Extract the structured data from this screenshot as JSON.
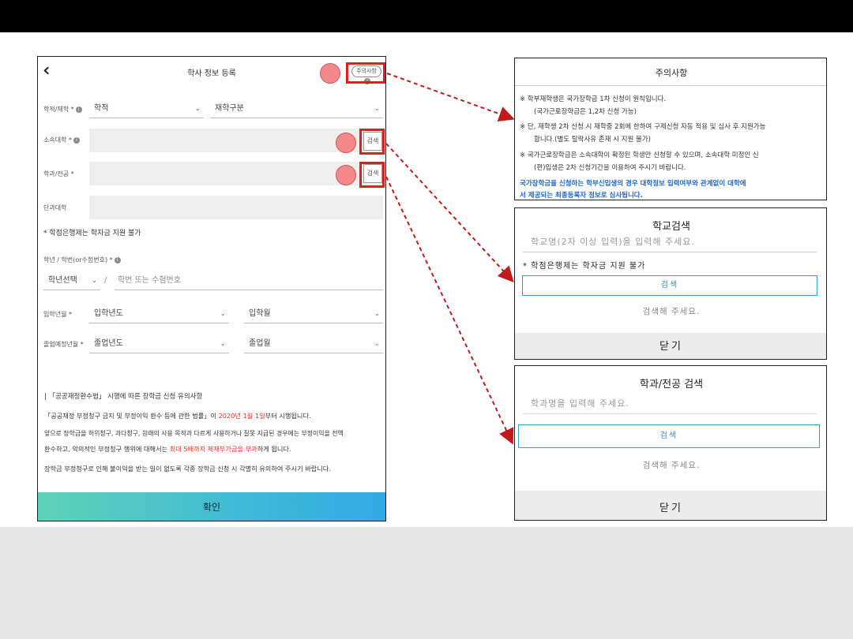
{
  "left": {
    "title": "학사 정보 등록",
    "notice_button": "주의사항",
    "info_glyph": "i",
    "rows": {
      "school_status_label": "학적/재학 *",
      "school_select": "학적",
      "enroll_select": "재학구분",
      "affiliation_label": "소속대학 *",
      "major_label": "학과/전공 *",
      "college_label": "단과대학",
      "search_label": "검색",
      "credit_bank_note": "* 학점은행제는 학자금 지원 불가",
      "student_id_label": "학년 / 학번(or수험번호) *",
      "grade_select": "학년선택",
      "slash": "/",
      "student_id_placeholder": "학번 또는 수험번호",
      "entrance_label": "입학년월 *",
      "entrance_year": "입학년도",
      "entrance_month": "입학월",
      "graduation_label": "졸업예정년월 *",
      "graduation_year": "졸업년도",
      "graduation_month": "졸업월"
    },
    "notice": {
      "heading": "| 「공공재정환수법」 시행에 따른 장학금 신청 유의사항",
      "line1a": "「공공재정 부정청구 금지 및 부정이익 환수 등에 관한 법률」이 ",
      "line1b": "2020년 1월 1일",
      "line1c": "부터 시행됩니다.",
      "line2": "앞으로 장학금을 허위청구, 과다청구, 원래의 사용 목적과 다르게 사용하거나 잘못 지급된 경우에는 부정이익을 전액",
      "line3a": "환수하고, 악의적인 부정청구 행위에 대해서는 ",
      "line3b": "최대 5배까지 제재부가금을 부과",
      "line3c": "하게 됩니다.",
      "line4": "장학금 부정청구로 인해 불이익을 받는 일이 없도록 각종 장학금 신청 시 각별히 유의하여 주시기 바랍니다."
    },
    "confirm": "확인"
  },
  "caution_panel": {
    "title": "주의사항",
    "l1": "※  학부재학생은 국가장학금 1차 신청이 원칙입니다.",
    "l2": "(국가근로장학금은 1,2차 신청 가능)",
    "l3": "※  단, 재학생 2차 신청 시 재학중 2회에 한하여 구제신청 자동 적용 및 심사 후 지원가능",
    "l4": "합니다.(별도 탈락사유 존재 시 지원 불가)",
    "l5": "※  국가근로장학금은 소속대학이 확정된 학생만 신청할 수 있으며, 소속대학 미정인 신",
    "l6": "(편)입생은 2차 신청기간을 이용하여 주시기 바랍니다.",
    "b1": "국가장학금을 신청하는 학부신입생의 경우 대학정보 입력여부와 관계없이 대학에",
    "b2": "서 제공되는 최종등록자 정보로 심사됩니다."
  },
  "school_search": {
    "title": "학교검색",
    "placeholder": "학교명(2자 이상 입력)을 입력해 주세요.",
    "note": "* 학점은행제는 학자금 지원 불가",
    "button": "검색",
    "hint": "검색해 주세요.",
    "close": "닫기"
  },
  "major_search": {
    "title": "학과/전공 검색",
    "placeholder": "학과명을 입력해 주세요.",
    "button": "검색",
    "hint": "검색해 주세요.",
    "close": "닫기"
  },
  "colors": {
    "highlight": "#e31d1d",
    "marker": "#f4888a",
    "accent_blue": "#1a66c9",
    "gradient_start": "#5fd3b7",
    "gradient_end": "#34a9e6"
  }
}
